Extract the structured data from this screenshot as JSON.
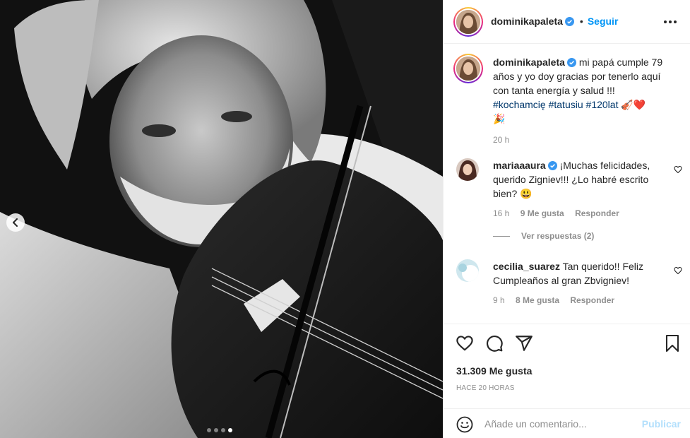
{
  "post": {
    "username": "dominikapaleta",
    "follow_label": "Seguir",
    "more_icon": "more-options-icon",
    "separator": "•"
  },
  "caption": {
    "username": "dominikapaleta",
    "text": "mi papá cumple 79 años y yo doy gracias por tenerlo aquí con tanta energía y salud !!!",
    "hashtags": [
      "#kochamcię",
      "#tatusiu",
      "#120lat"
    ],
    "emojis": "🎻❤️",
    "emoji_end": "🎉",
    "time": "20 h"
  },
  "comments": [
    {
      "username": "mariaaaura",
      "verified": true,
      "text": "¡Muchas felicidades, querido Zigniev!!! ¿Lo habré escrito bien? 😃",
      "time": "16 h",
      "likes": "9 Me gusta",
      "reply": "Responder",
      "view_replies": "Ver respuestas (2)"
    },
    {
      "username": "cecilia_suarez",
      "verified": false,
      "text": "Tan querido!! Feliz Cumpleaños al gran Zbvigniev!",
      "time": "9 h",
      "likes": "8 Me gusta",
      "reply": "Responder"
    }
  ],
  "actions": {
    "likes": "31.309 Me gusta",
    "time_ago": "HACE 20 HORAS",
    "icons": [
      "heart-icon",
      "comment-icon",
      "share-icon",
      "bookmark-icon"
    ]
  },
  "add_comment": {
    "placeholder": "Añade un comentario...",
    "publish_label": "Publicar"
  },
  "carousel": {
    "total": 4,
    "active_index": 3
  },
  "colors": {
    "accent": "#0095f6",
    "publish_disabled": "#b2dffc",
    "hashtag": "#00376b",
    "muted": "#8e8e8e"
  }
}
